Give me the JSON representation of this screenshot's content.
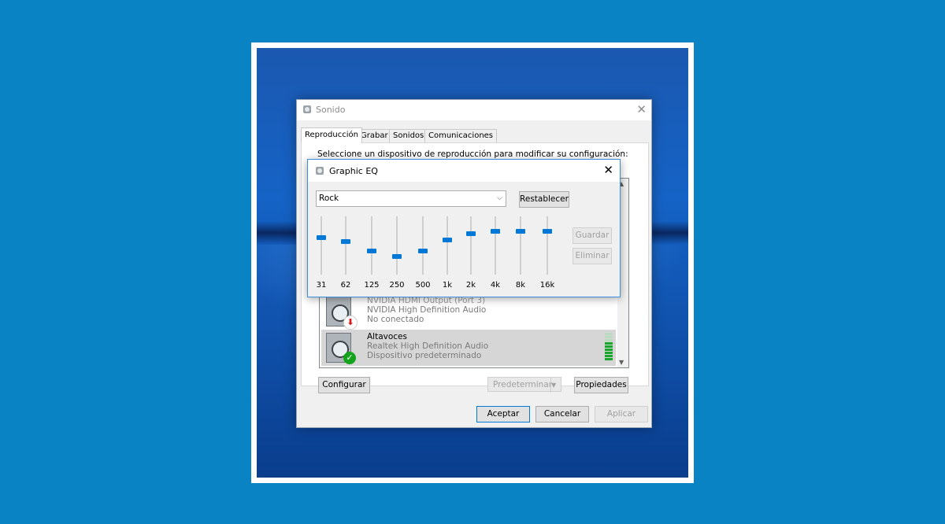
{
  "sound_window": {
    "title": "Sonido",
    "tabs": [
      "Reproducción",
      "Grabar",
      "Sonidos",
      "Comunicaciones"
    ],
    "instruction": "Seleccione un dispositivo de reproducción para modificar su configuración:",
    "devices": [
      {
        "name": "NVIDIA HDMI Output (Port 3)",
        "driver": "NVIDIA High Definition Audio",
        "status": "No conectado"
      },
      {
        "name": "Altavoces",
        "driver": "Realtek High Definition Audio",
        "status": "Dispositivo predeterminado",
        "meter_level_fraction": 0.7
      }
    ],
    "buttons": {
      "configure": "Configurar",
      "set_default": "Predeterminar",
      "properties": "Propiedades",
      "ok": "Aceptar",
      "cancel": "Cancelar",
      "apply": "Aplicar"
    }
  },
  "eq_window": {
    "title": "Graphic EQ",
    "preset": "Rock",
    "buttons": {
      "reset": "Restablecer",
      "save": "Guardar",
      "delete": "Eliminar"
    },
    "bands": [
      {
        "label": "31",
        "level": 0.65
      },
      {
        "label": "62",
        "level": 0.58
      },
      {
        "label": "125",
        "level": 0.4
      },
      {
        "label": "250",
        "level": 0.3
      },
      {
        "label": "500",
        "level": 0.4
      },
      {
        "label": "1k",
        "level": 0.6
      },
      {
        "label": "2k",
        "level": 0.72
      },
      {
        "label": "4k",
        "level": 0.76
      },
      {
        "label": "8k",
        "level": 0.76
      },
      {
        "label": "16k",
        "level": 0.76
      }
    ]
  },
  "colors": {
    "background": "#0a83c4",
    "accent": "#0078d7",
    "default_check": "#14a31c",
    "disconnected_arrow": "#d71920"
  }
}
